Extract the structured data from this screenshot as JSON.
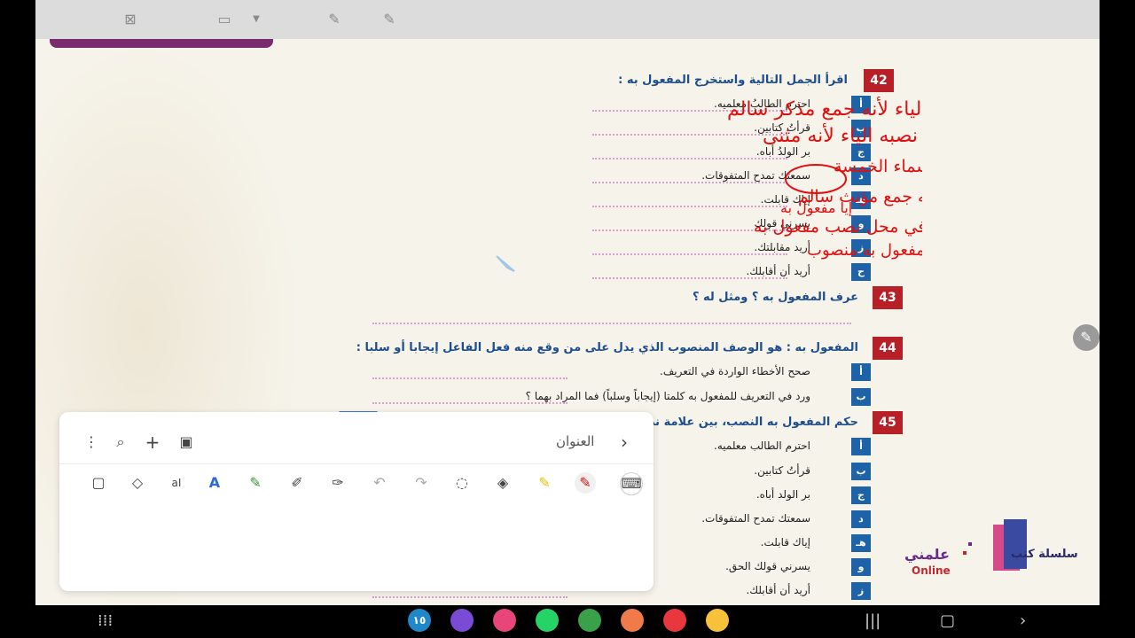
{
  "toolbar_top": {
    "icons": [
      "close-presentation-icon",
      "screen-icon",
      "dropdown-arrow-icon",
      "pen-off-icon",
      "pen-icon"
    ]
  },
  "worksheet": {
    "q42": {
      "num": "42",
      "title": "اقرأ الجمل التالية واستخرج المفعول به :",
      "items": [
        {
          "letter": "أ",
          "text": "احترم الطالبُ معلميه."
        },
        {
          "letter": "ب",
          "text": "قرأتُ كتابين."
        },
        {
          "letter": "ج",
          "text": "بر الولدُ أباه."
        },
        {
          "letter": "د",
          "text": "سمعتك تمدح المتفوقات."
        },
        {
          "letter": "هـ",
          "text": "إياك قابلت."
        },
        {
          "letter": "و",
          "text": "يسرني قولك"
        },
        {
          "letter": "ز",
          "text": "أريد مقابلتك."
        },
        {
          "letter": "ح",
          "text": "أريد أن أقابلك."
        }
      ]
    },
    "q43": {
      "num": "43",
      "title": "عرف المفعول به ؟ ومثل له ؟"
    },
    "q44": {
      "num": "44",
      "title": "المفعول به : هو الوصف المنصوب الذي يدل على من وقع منه فعل الفاعل إيجابا أو سلبا :",
      "items": [
        {
          "letter": "أ",
          "text": "صحح الأخطاء الواردة في التعريف."
        },
        {
          "letter": "ب",
          "text": "ورد في التعريف للمفعول به كلمتا (إيجاباً وسلباً) فما المراد بهما ؟"
        }
      ]
    },
    "q45": {
      "num": "45",
      "title": "حكم المفعول به النصب، بين علامة نصب",
      "items": [
        {
          "letter": "أ",
          "text": "احترم الطالب معلميه."
        },
        {
          "letter": "ب",
          "text": "قرأتُ كتابين."
        },
        {
          "letter": "ج",
          "text": "بر الولد أباه."
        },
        {
          "letter": "د",
          "text": "سمعتك تمدح المتفوقات."
        },
        {
          "letter": "هـ",
          "text": "إياك قابلت."
        },
        {
          "letter": "و",
          "text": "يسرني قولك الحق."
        },
        {
          "letter": "ز",
          "text": "أريد أن أقابلك."
        }
      ]
    }
  },
  "handwriting": {
    "lines": [
      "معلمي مفعول به منصوب وعلامة نصبه الياء لأنه جمع مذكر سالم",
      "كتابين مفعول به منصوب وعلامة نصبه الياء لأنه مثنى",
      "أباه مفعول به منصوب وعلامة نصبه الألف لأنه من الأسماء الخمسة",
      "المتفوقات مفعول به منصوب وعلامة نصبه الكسرة لأنه جمع مؤنث سالم",
      "إيا مفعول به",
      "الياء ضمير في محل نصب مفعول به",
      "مفعول به منصوب"
    ]
  },
  "logo": {
    "series": "سلسلة كتب",
    "name": "علمني",
    "online": "Online"
  },
  "notes_panel": {
    "title": "العنوان",
    "tools": [
      "more-icon",
      "search-icon",
      "add-icon",
      "book-icon",
      "lock-icon",
      "shapes-icon",
      "text-box-icon",
      "text-style-icon",
      "marker-icon",
      "pen-plus-icon",
      "pen-settings-icon",
      "undo-icon",
      "redo-icon",
      "lasso-icon",
      "eraser-icon",
      "highlighter-icon",
      "pen-red-icon",
      "keyboard-icon"
    ]
  },
  "dock": {
    "apps": [
      {
        "name": "calendar-app",
        "label": "١٥",
        "color": "#1e88c9"
      },
      {
        "name": "browser-app",
        "label": "",
        "color": "#7a4cd6"
      },
      {
        "name": "store-app",
        "label": "",
        "color": "#e8457a"
      },
      {
        "name": "whatsapp-app",
        "label": "",
        "color": "#25d366"
      },
      {
        "name": "calculator-app",
        "label": "",
        "color": "#3aa14a"
      },
      {
        "name": "contacts-app",
        "label": "",
        "color": "#f07a4a"
      },
      {
        "name": "notes-app",
        "label": "",
        "color": "#e8383d"
      },
      {
        "name": "files-app",
        "label": "",
        "color": "#f7c23a"
      }
    ]
  }
}
